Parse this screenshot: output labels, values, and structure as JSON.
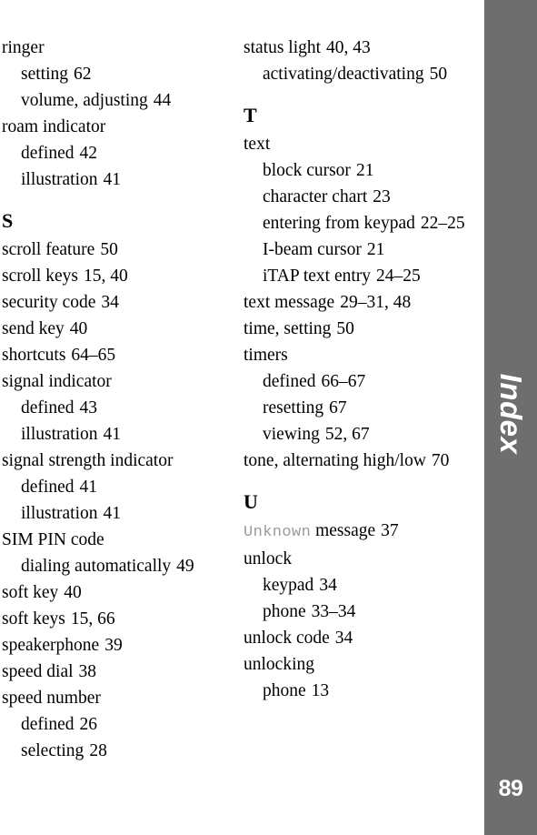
{
  "document": {
    "type": "book-index-page",
    "page_number": "89",
    "tab_label": "Index",
    "tab_color": "#6e6e6e",
    "tab_text_color": "#ffffff",
    "text_color": "#000000",
    "mono_reference_color": "#9a9a9a"
  },
  "columns": [
    {
      "name": "left-column",
      "blocks": [
        {
          "type": "entries",
          "entries": [
            {
              "level": "main",
              "label": "ringer",
              "pages": ""
            },
            {
              "level": "sub",
              "label": "setting",
              "pages": "62"
            },
            {
              "level": "sub",
              "label": "volume, adjusting",
              "pages": "44"
            },
            {
              "level": "main",
              "label": "roam indicator",
              "pages": ""
            },
            {
              "level": "sub",
              "label": "defined",
              "pages": "42"
            },
            {
              "level": "sub",
              "label": "illustration",
              "pages": "41"
            }
          ]
        },
        {
          "type": "section",
          "letter": "S",
          "entries": [
            {
              "level": "main",
              "label": "scroll feature",
              "pages": "50"
            },
            {
              "level": "main",
              "label": "scroll keys",
              "pages": "15, 40"
            },
            {
              "level": "main",
              "label": "security code",
              "pages": "34"
            },
            {
              "level": "main",
              "label": "send key",
              "pages": "40"
            },
            {
              "level": "main",
              "label": "shortcuts",
              "pages": "64–65"
            },
            {
              "level": "main",
              "label": "signal indicator",
              "pages": ""
            },
            {
              "level": "sub",
              "label": "defined",
              "pages": "43"
            },
            {
              "level": "sub",
              "label": "illustration",
              "pages": "41"
            },
            {
              "level": "main",
              "label": "signal strength indicator",
              "pages": ""
            },
            {
              "level": "sub",
              "label": "defined",
              "pages": "41"
            },
            {
              "level": "sub",
              "label": "illustration",
              "pages": "41"
            },
            {
              "level": "main",
              "label": "SIM PIN code",
              "pages": ""
            },
            {
              "level": "sub",
              "label": "dialing automatically",
              "pages": "49"
            },
            {
              "level": "main",
              "label": "soft key",
              "pages": "40"
            },
            {
              "level": "main",
              "label": "soft keys",
              "pages": "15, 66"
            },
            {
              "level": "main",
              "label": "speakerphone",
              "pages": "39"
            },
            {
              "level": "main",
              "label": "speed dial",
              "pages": "38"
            },
            {
              "level": "main",
              "label": "speed number",
              "pages": ""
            },
            {
              "level": "sub",
              "label": "defined",
              "pages": "26"
            },
            {
              "level": "sub",
              "label": "selecting",
              "pages": "28"
            }
          ]
        }
      ]
    },
    {
      "name": "right-column",
      "blocks": [
        {
          "type": "entries",
          "entries": [
            {
              "level": "main",
              "label": "status light",
              "pages": "40, 43"
            },
            {
              "level": "sub",
              "label": "activating/deactivating",
              "pages": "50"
            }
          ]
        },
        {
          "type": "section",
          "letter": "T",
          "entries": [
            {
              "level": "main",
              "label": "text",
              "pages": ""
            },
            {
              "level": "sub",
              "label": "block cursor",
              "pages": "21"
            },
            {
              "level": "sub",
              "label": "character chart",
              "pages": "23"
            },
            {
              "level": "sub",
              "label": "entering from keypad",
              "pages": "22–25"
            },
            {
              "level": "sub",
              "label": "I-beam cursor",
              "pages": "21"
            },
            {
              "level": "sub",
              "label": "iTAP text entry",
              "pages": "24–25"
            },
            {
              "level": "main",
              "label": "text message",
              "pages": "29–31, 48"
            },
            {
              "level": "main",
              "label": "time, setting",
              "pages": "50"
            },
            {
              "level": "main",
              "label": "timers",
              "pages": ""
            },
            {
              "level": "sub",
              "label": "defined",
              "pages": "66–67"
            },
            {
              "level": "sub",
              "label": "resetting",
              "pages": "67"
            },
            {
              "level": "sub",
              "label": "viewing",
              "pages": "52, 67"
            },
            {
              "level": "main",
              "label": "tone, alternating high/low",
              "pages": "70"
            }
          ]
        },
        {
          "type": "section",
          "letter": "U",
          "entries": [
            {
              "level": "main",
              "label_mono": "Unknown",
              "label": " message",
              "pages": "37"
            },
            {
              "level": "main",
              "label": "unlock",
              "pages": ""
            },
            {
              "level": "sub",
              "label": "keypad",
              "pages": "34"
            },
            {
              "level": "sub",
              "label": "phone",
              "pages": "33–34"
            },
            {
              "level": "main",
              "label": "unlock code",
              "pages": "34"
            },
            {
              "level": "main",
              "label": "unlocking",
              "pages": ""
            },
            {
              "level": "sub",
              "label": "phone",
              "pages": "13"
            }
          ]
        }
      ]
    }
  ]
}
